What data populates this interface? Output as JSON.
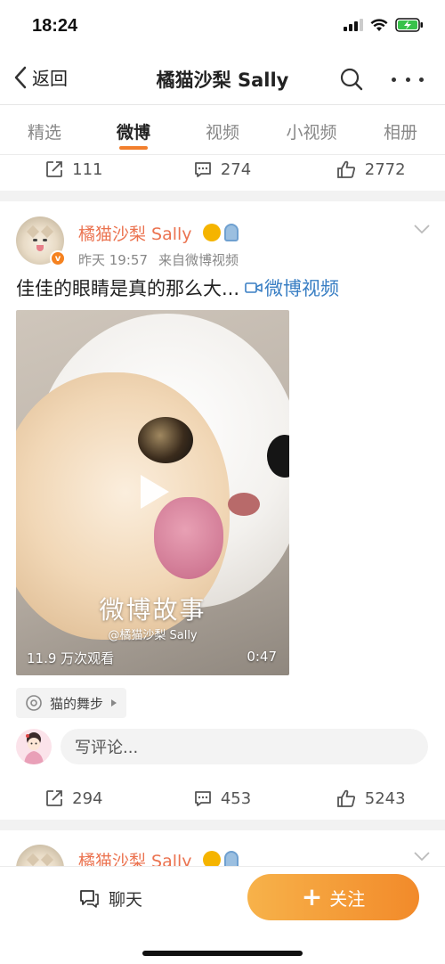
{
  "status": {
    "time": "18:24"
  },
  "nav": {
    "back_label": "返回",
    "title": "橘猫沙梨 Sally"
  },
  "tabs": [
    {
      "label": "精选"
    },
    {
      "label": "微博"
    },
    {
      "label": "视频"
    },
    {
      "label": "小视频"
    },
    {
      "label": "相册"
    }
  ],
  "prev_post": {
    "reposts": "111",
    "comments": "274",
    "likes": "2772"
  },
  "post": {
    "author": "橘猫沙梨 Sally",
    "time": "昨天 19:57",
    "source": "来自微博视频",
    "text": "佳佳的眼睛是真的那么大...",
    "link_label": "微博视频",
    "video": {
      "brand": "微博故事",
      "handle": "@橘猫沙梨 Sally",
      "views": "11.9 万次观看",
      "duration": "0:47"
    },
    "topic": "猫的舞步",
    "comment_placeholder": "写评论...",
    "reposts": "294",
    "comments": "453",
    "likes": "5243"
  },
  "next_post": {
    "author": "橘猫沙梨 Sally"
  },
  "bottom": {
    "chat_label": "聊天",
    "follow_label": "关注"
  },
  "colors": {
    "accent": "#f28a2a",
    "author": "#eb7350",
    "link": "#3a7fc4"
  }
}
